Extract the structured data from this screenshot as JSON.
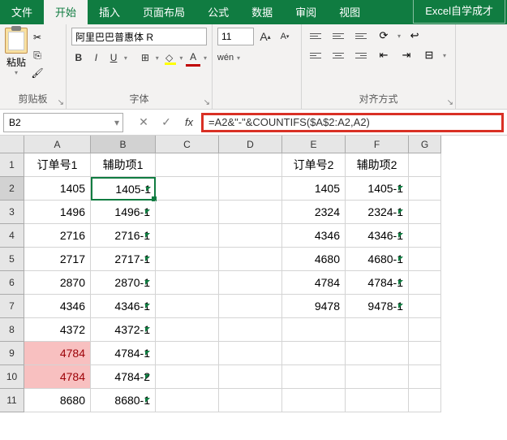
{
  "ribbon": {
    "tabs": [
      "文件",
      "开始",
      "插入",
      "页面布局",
      "公式",
      "数据",
      "审阅",
      "视图",
      "Excel自学成才"
    ],
    "active_tab": "开始",
    "clipboard": {
      "paste": "粘贴",
      "group_label": "剪贴板"
    },
    "font": {
      "name": "阿里巴巴普惠体 R",
      "size": "11",
      "group_label": "字体",
      "wen": "wén"
    },
    "align": {
      "group_label": "对齐方式"
    }
  },
  "name_box": "B2",
  "formula": "=A2&\"-\"&COUNTIFS($A$2:A2,A2)",
  "columns": [
    "A",
    "B",
    "C",
    "D",
    "E",
    "F",
    "G"
  ],
  "rows": [
    "1",
    "2",
    "3",
    "4",
    "5",
    "6",
    "7",
    "8",
    "9",
    "10",
    "11"
  ],
  "headers": {
    "A": "订单号1",
    "B": "辅助项1",
    "E": "订单号2",
    "F": "辅助项2"
  },
  "data": {
    "A": [
      "1405",
      "1496",
      "2716",
      "2717",
      "2870",
      "4346",
      "4372",
      "4784",
      "4784",
      "8680"
    ],
    "B": [
      "1405-1",
      "1496-1",
      "2716-1",
      "2717-1",
      "2870-1",
      "4346-1",
      "4372-1",
      "4784-1",
      "4784-2",
      "8680-1"
    ],
    "E": [
      "1405",
      "2324",
      "4346",
      "4680",
      "4784",
      "9478",
      "",
      "",
      "",
      ""
    ],
    "F": [
      "1405-1",
      "2324-1",
      "4346-1",
      "4680-1",
      "4784-1",
      "9478-1",
      "",
      "",
      "",
      ""
    ]
  },
  "highlighted_rows_A": [
    9,
    10
  ],
  "chart_data": {
    "type": "table",
    "title": "",
    "columns": [
      "订单号1",
      "辅助项1",
      "订单号2",
      "辅助项2"
    ],
    "rows": [
      [
        "1405",
        "1405-1",
        "1405",
        "1405-1"
      ],
      [
        "1496",
        "1496-1",
        "2324",
        "2324-1"
      ],
      [
        "2716",
        "2716-1",
        "4346",
        "4346-1"
      ],
      [
        "2717",
        "2717-1",
        "4680",
        "4680-1"
      ],
      [
        "2870",
        "2870-1",
        "4784",
        "4784-1"
      ],
      [
        "4346",
        "4346-1",
        "9478",
        "9478-1"
      ],
      [
        "4372",
        "4372-1",
        "",
        ""
      ],
      [
        "4784",
        "4784-1",
        "",
        ""
      ],
      [
        "4784",
        "4784-2",
        "",
        ""
      ],
      [
        "8680",
        "8680-1",
        "",
        ""
      ]
    ]
  }
}
